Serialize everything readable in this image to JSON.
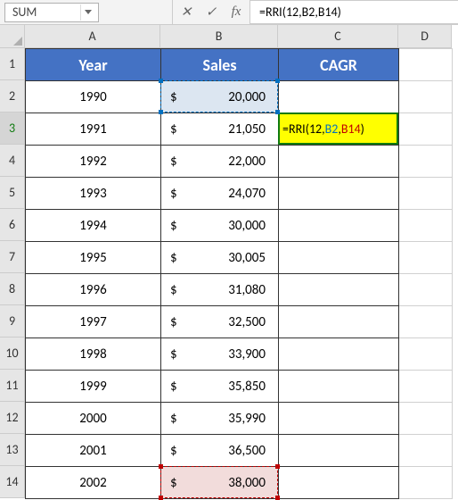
{
  "formula_bar": {
    "name_box": "SUM",
    "cancel_icon": "✕",
    "confirm_icon": "✓",
    "fx_label": "fx",
    "formula_prefix": "=RRI(12,",
    "formula_ref1": "B2",
    "formula_sep": ",",
    "formula_ref2": "B14",
    "formula_suffix": ")"
  },
  "columns": {
    "A": {
      "label": "A",
      "width": 152
    },
    "B": {
      "label": "B",
      "width": 132
    },
    "C": {
      "label": "C",
      "width": 135
    },
    "D": {
      "label": "D",
      "width": 60
    }
  },
  "headers": {
    "year": "Year",
    "sales": "Sales",
    "cagr": "CAGR"
  },
  "row_height_header": 36,
  "row_height_data": 36,
  "row_labels": [
    "1",
    "2",
    "3",
    "4",
    "5",
    "6",
    "7",
    "8",
    "9",
    "10",
    "11",
    "12",
    "13",
    "14"
  ],
  "currency": "$",
  "rows": [
    {
      "year": "1990",
      "sales": "20,000"
    },
    {
      "year": "1991",
      "sales": "21,050"
    },
    {
      "year": "1992",
      "sales": "22,000"
    },
    {
      "year": "1993",
      "sales": "24,070"
    },
    {
      "year": "1994",
      "sales": "30,000"
    },
    {
      "year": "1995",
      "sales": "30,005"
    },
    {
      "year": "1996",
      "sales": "31,080"
    },
    {
      "year": "1997",
      "sales": "32,500"
    },
    {
      "year": "1998",
      "sales": "33,900"
    },
    {
      "year": "1999",
      "sales": "35,850"
    },
    {
      "year": "2000",
      "sales": "35,990"
    },
    {
      "year": "2001",
      "sales": "36,500"
    },
    {
      "year": "2002",
      "sales": "38,000"
    }
  ],
  "active_formula": {
    "prefix": "=RRI(12,",
    "ref1": "B2",
    "sep": ",",
    "ref2": "B14",
    "suffix": ")"
  }
}
